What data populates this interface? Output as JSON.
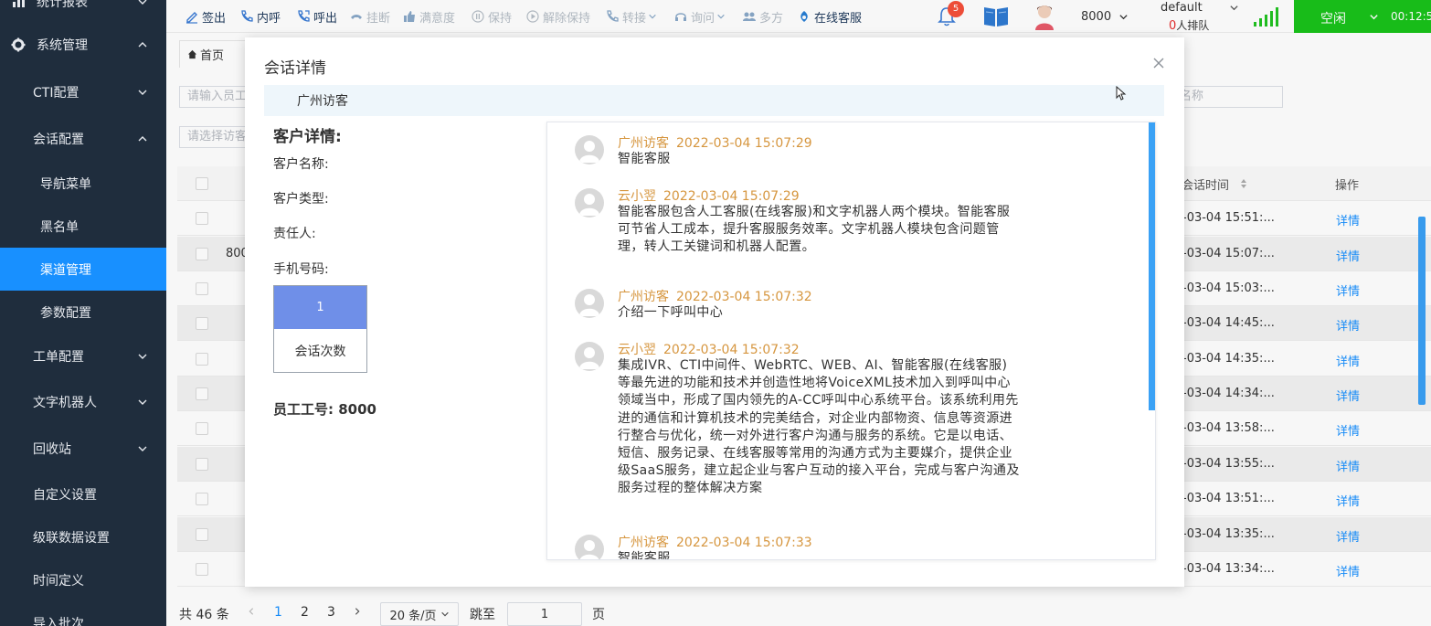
{
  "sidebar": {
    "top_partial": "统计报表",
    "system": "系统管理",
    "items": [
      {
        "label": "CTI配置",
        "expand": "down"
      },
      {
        "label": "会话配置",
        "expand": "up"
      },
      {
        "label": "导航菜单"
      },
      {
        "label": "黑名单"
      },
      {
        "label": "渠道管理",
        "active": true
      },
      {
        "label": "参数配置"
      },
      {
        "label": "工单配置",
        "expand": "down"
      },
      {
        "label": "文字机器人",
        "expand": "down"
      },
      {
        "label": "回收站",
        "expand": "down"
      },
      {
        "label": "自定义设置"
      },
      {
        "label": "级联数据设置"
      },
      {
        "label": "时间定义"
      },
      {
        "label": "导入批次"
      }
    ]
  },
  "toolbar": {
    "signout": "签出",
    "internal_call": "内呼",
    "outbound": "呼出",
    "hangup": "挂断",
    "satisfaction": "满意度",
    "hold": "保持",
    "unhold": "解除保持",
    "transfer": "转接",
    "consult": "询问",
    "multiparty": "多方",
    "online_service": "在线客服",
    "notification_count": "5",
    "extension": "8000",
    "queue_name": "default",
    "queue_count": "0",
    "queue_suffix": "人排队",
    "status": "空闲",
    "timer": "00:12:5"
  },
  "page": {
    "home_tab": "首页",
    "filter_employee_placeholder": "请输入员工",
    "filter_select_placeholder": "请选择访客",
    "filter_name_placeholder": "名称",
    "col_session_time": "会话时间",
    "col_actions": "操作",
    "row_fragment": "800",
    "rows": [
      {
        "time": "-03-04 15:51:...",
        "action": "详情"
      },
      {
        "time": "-03-04 15:07:...",
        "action": "详情"
      },
      {
        "time": "-03-04 15:03:...",
        "action": "详情"
      },
      {
        "time": "-03-04 14:45:...",
        "action": "详情"
      },
      {
        "time": "-03-04 14:35:...",
        "action": "详情"
      },
      {
        "time": "-03-04 14:34:...",
        "action": "详情"
      },
      {
        "time": "-03-04 13:58:...",
        "action": "详情"
      },
      {
        "time": "-03-04 13:55:...",
        "action": "详情"
      },
      {
        "time": "-03-04 13:51:...",
        "action": "详情"
      },
      {
        "time": "-03-04 13:35:...",
        "action": "详情"
      },
      {
        "time": "-03-04 13:34:...",
        "action": "详情"
      }
    ]
  },
  "pagination": {
    "total": "共 46 条",
    "pages": [
      "1",
      "2",
      "3"
    ],
    "page_size": "20 条/页",
    "jump_label": "跳至",
    "jump_value": "1",
    "page_suffix": "页"
  },
  "modal": {
    "title": "会话详情",
    "visitor": "广州访客",
    "customer_title": "客户详情:",
    "customer_name": "客户名称:",
    "customer_type": "客户类型:",
    "owner": "责任人:",
    "phone": "手机号码:",
    "session_count": "1",
    "session_count_label": "会话次数",
    "employee_id": "员工工号: 8000",
    "messages": [
      {
        "sender": "广州访客",
        "time": "2022-03-04 15:07:29",
        "text": "智能客服"
      },
      {
        "sender": "云小翌",
        "time": "2022-03-04 15:07:29",
        "text": "智能客服包含人工客服(在线客服)和文字机器人两个模块。智能客服可节省人工成本，提升客服服务效率。文字机器人模块包含问题管理，转人工关键词和机器人配置。"
      },
      {
        "sender": "广州访客",
        "time": "2022-03-04 15:07:32",
        "text": "介绍一下呼叫中心"
      },
      {
        "sender": "云小翌",
        "time": "2022-03-04 15:07:32",
        "text": "集成IVR、CTI中间件、WebRTC、WEB、AI、智能客服(在线客服)等最先进的功能和技术并创造性地将VoiceXML技术加入到呼叫中心领域当中，形成了国内领先的A-CC呼叫中心系统平台。该系统利用先进的通信和计算机技术的完美结合，对企业内部物资、信息等资源进行整合与优化，统一对外进行客户沟通与服务的系统。它是以电话、短信、服务记录、在线客服等常用的沟通方式为主要媒介，提供企业级SaaS服务，建立起企业与客户互动的接入平台，完成与客户沟通及服务过程的整体解决方案"
      },
      {
        "sender": "广州访客",
        "time": "2022-03-04 15:07:33",
        "text": "智能客服"
      }
    ]
  }
}
